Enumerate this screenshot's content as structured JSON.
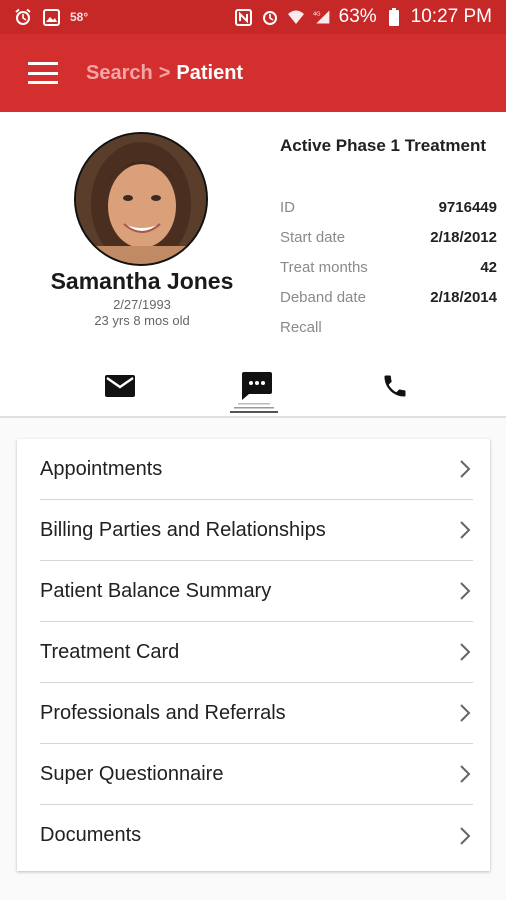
{
  "status_bar": {
    "temperature": "58°",
    "battery": "63%",
    "time": "10:27 PM"
  },
  "app_bar": {
    "breadcrumb_parent": "Search",
    "breadcrumb_separator": ">",
    "breadcrumb_current": "Patient"
  },
  "patient": {
    "name": "Samantha Jones",
    "dob": "2/27/1993",
    "age": "23 yrs 8 mos old"
  },
  "treatment": {
    "phase": "Active Phase 1 Treatment",
    "fields": [
      {
        "label": "ID",
        "value": "9716449"
      },
      {
        "label": "Start date",
        "value": "2/18/2012"
      },
      {
        "label": "Treat months",
        "value": "42"
      },
      {
        "label": "Deband date",
        "value": "2/18/2014"
      },
      {
        "label": "Recall",
        "value": ""
      }
    ]
  },
  "contact_actions": [
    "email-icon",
    "message-icon",
    "phone-icon"
  ],
  "menu": {
    "items": [
      {
        "label": "Appointments"
      },
      {
        "label": "Billing Parties and Relationships"
      },
      {
        "label": "Patient Balance Summary"
      },
      {
        "label": "Treatment Card"
      },
      {
        "label": "Professionals and Referrals"
      },
      {
        "label": "Super Questionnaire"
      },
      {
        "label": "Documents"
      }
    ]
  },
  "colors": {
    "app_bar": "#d32f2f",
    "status_bar": "#c62828",
    "breadcrumb_link": "#f4a5a5"
  }
}
